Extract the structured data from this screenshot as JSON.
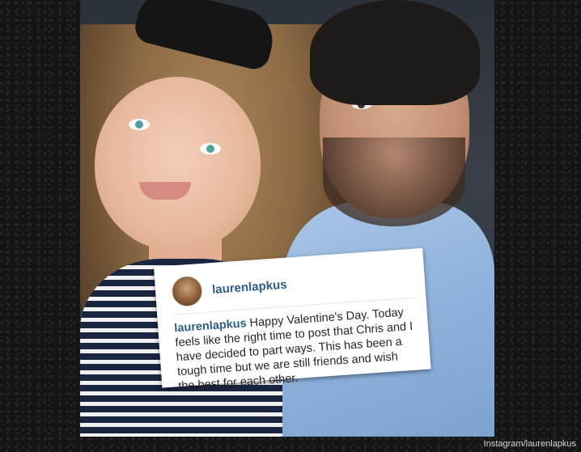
{
  "photo": {
    "description_icon": "selfie-photo"
  },
  "instagram_post": {
    "header_username": "laurenlapkus",
    "caption_username": "laurenlapkus",
    "caption_text": " Happy Valentine's Day. Today feels like the right time to post that Chris and I have decided to part ways. This has been a tough time but we are still friends and wish the best for each other."
  },
  "credit": "Instagram/laurenlapkus",
  "colors": {
    "username_blue": "#2a5e8c",
    "card_background": "#ffffff"
  }
}
